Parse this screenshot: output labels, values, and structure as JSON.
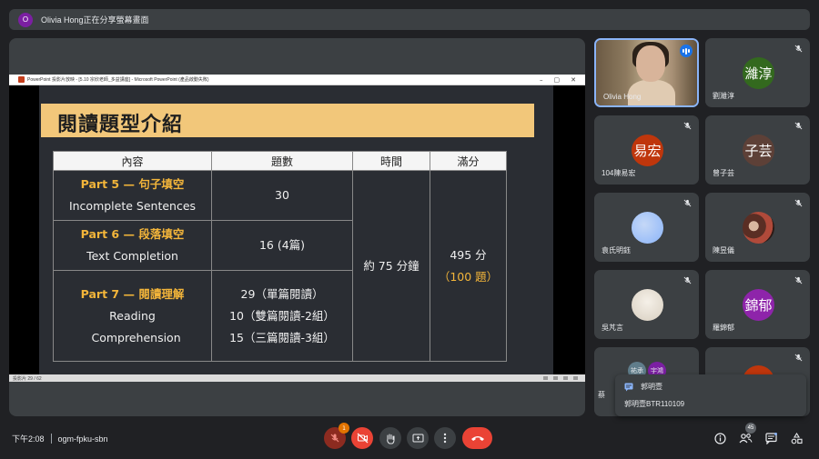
{
  "share_banner": {
    "avatar_letter": "O",
    "text": "Olivia Hong正在分享螢幕畫面"
  },
  "ppt": {
    "window_title": "PowerPoint 投影片放映 - [5.10 宗欣老師_多益講座] - Microsoft PowerPoint (產品啟動失敗)",
    "status_text": "投影片 29 / 62",
    "slide": {
      "title": "閱讀題型介紹",
      "headers": [
        "內容",
        "題數",
        "時間",
        "滿分"
      ],
      "rows": [
        {
          "part": "Part 5 — 句子填空",
          "desc": "Incomplete Sentences",
          "count": [
            "30"
          ]
        },
        {
          "part": "Part 6 — 段落填空",
          "desc": "Text Completion",
          "count": [
            "16 (4篇)"
          ]
        },
        {
          "part": "Part 7 — 閱讀理解",
          "desc": "Reading Comprehension",
          "count": [
            "29（單篇閱讀）",
            "10（雙篇閱讀-2組）",
            "15（三篇閱讀-3組）"
          ]
        }
      ],
      "time": "約 75 分鐘",
      "score": "495 分",
      "score_sub": "（100 題）"
    }
  },
  "participants": [
    {
      "name": "Olivia Hong",
      "avatar": "",
      "color": "",
      "video": true
    },
    {
      "name": "劉濰淳",
      "avatar": "濰淳",
      "color": "#33691e"
    },
    {
      "name": "104陳易宏",
      "avatar": "易宏",
      "color": "#bf360c"
    },
    {
      "name": "曾子芸",
      "avatar": "子芸",
      "color": "#5d4037"
    },
    {
      "name": "袁氏明鈺",
      "avatar": "",
      "color": "#8ab4f8"
    },
    {
      "name": "陳昱儀",
      "avatar": "",
      "color": "#7a4a3a"
    },
    {
      "name": "吳芃言",
      "avatar": "",
      "color": "#e8e0d4"
    },
    {
      "name": "羅錦郁",
      "avatar": "錦郁",
      "color": "#8e24aa"
    }
  ],
  "partial_tiles": {
    "left_labels": [
      "祐承",
      "宇鴻"
    ],
    "left_name": "蔡"
  },
  "notification": {
    "sender": "郭明壹",
    "message": "郭明壹BTR110109"
  },
  "bottom": {
    "time": "下午2:08",
    "meeting_code": "ogm-fpku-sbn",
    "mic_badge": "1",
    "participant_count": "45"
  },
  "colors": {
    "accent": "#8ab4f8",
    "danger": "#ea4335",
    "slide_title_bg": "#f2c77a",
    "part_label": "#f3b53a"
  },
  "icons": [
    "mic-off-icon",
    "camera-off-icon",
    "hand-icon",
    "present-icon",
    "more-icon",
    "hangup-icon",
    "info-icon",
    "people-icon",
    "chat-icon",
    "activities-icon",
    "speaking-icon"
  ]
}
